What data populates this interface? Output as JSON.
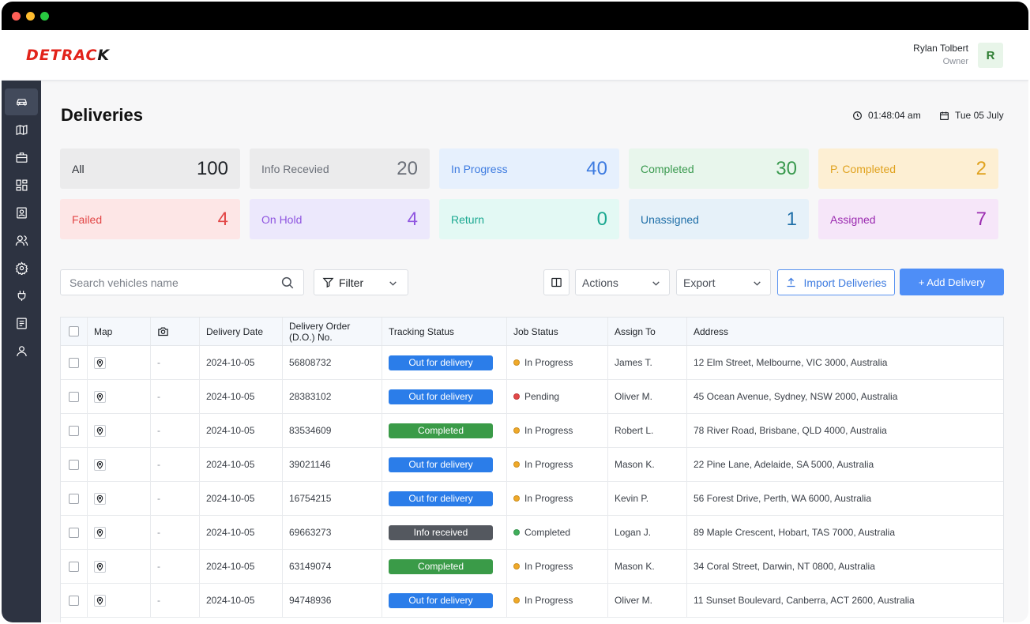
{
  "brand": {
    "logo_main": "DETRAC",
    "logo_tail": "K"
  },
  "user": {
    "name": "Rylan Tolbert",
    "role": "Owner",
    "initial": "R"
  },
  "page": {
    "title": "Deliveries",
    "time": "01:48:04 am",
    "date": "Tue 05 July"
  },
  "sidebar": {
    "items": [
      {
        "icon": "car-icon",
        "active": true
      },
      {
        "icon": "map-icon",
        "active": false
      },
      {
        "icon": "briefcase-icon",
        "active": false
      },
      {
        "icon": "dashboard-icon",
        "active": false
      },
      {
        "icon": "contact-card-icon",
        "active": false
      },
      {
        "icon": "users-icon",
        "active": false
      },
      {
        "icon": "settings-icon",
        "active": false
      },
      {
        "icon": "plug-icon",
        "active": false
      },
      {
        "icon": "document-icon",
        "active": false
      },
      {
        "icon": "user-icon",
        "active": false
      }
    ]
  },
  "status_cards": [
    {
      "label": "All",
      "count": "100",
      "bg": "#ebebec",
      "fg": "#2b2f36",
      "count_fg": "#1f2328"
    },
    {
      "label": "Info Recevied",
      "count": "20",
      "bg": "#ebebec",
      "fg": "#6b7079",
      "count_fg": "#6b7079"
    },
    {
      "label": "In Progress",
      "count": "40",
      "bg": "#e6f0fd",
      "fg": "#3d7be0",
      "count_fg": "#3d7be0"
    },
    {
      "label": "Completed",
      "count": "30",
      "bg": "#e8f6ec",
      "fg": "#3a9a4f",
      "count_fg": "#3a9a4f"
    },
    {
      "label": "P. Completed",
      "count": "2",
      "bg": "#fdefd3",
      "fg": "#e0a21e",
      "count_fg": "#e0a21e"
    },
    {
      "label": "Failed",
      "count": "4",
      "bg": "#fde6e6",
      "fg": "#e24646",
      "count_fg": "#e24646"
    },
    {
      "label": "On Hold",
      "count": "4",
      "bg": "#ece8fc",
      "fg": "#8f55e0",
      "count_fg": "#8f55e0"
    },
    {
      "label": "Return",
      "count": "0",
      "bg": "#e3f9f4",
      "fg": "#1aa890",
      "count_fg": "#1aa890"
    },
    {
      "label": "Unassigned",
      "count": "1",
      "bg": "#e6f1f9",
      "fg": "#1f6fa8",
      "count_fg": "#1f6fa8"
    },
    {
      "label": "Assigned",
      "count": "7",
      "bg": "#f6e6f9",
      "fg": "#9b2bb0",
      "count_fg": "#9b2bb0"
    }
  ],
  "toolbar": {
    "search_placeholder": "Search vehicles name",
    "filter_label": "Filter",
    "actions_label": "Actions",
    "export_label": "Export",
    "import_label": "Import Deliveries",
    "add_label": "+ Add Delivery"
  },
  "table": {
    "headers": {
      "map": "Map",
      "delivery_date": "Delivery Date",
      "do_line1": "Delivery Order",
      "do_line2": "(D.O.) No.",
      "tracking": "Tracking Status",
      "job": "Job Status",
      "assign": "Assign To",
      "address": "Address"
    },
    "status_colors": {
      "Out for delivery": "#2b7de9",
      "Completed": "#3a9b48",
      "Info received": "#54585f"
    },
    "job_colors": {
      "In Progress": "#f0a928",
      "Pending": "#e34848",
      "Completed": "#3fae5a"
    },
    "rows": [
      {
        "photo": "-",
        "date": "2024-10-05",
        "do": "56808732",
        "tracking": "Out for delivery",
        "job": "In Progress",
        "assign": "James T.",
        "address": "12 Elm Street, Melbourne, VIC 3000, Australia"
      },
      {
        "photo": "-",
        "date": "2024-10-05",
        "do": "28383102",
        "tracking": "Out for delivery",
        "job": "Pending",
        "assign": "Oliver M.",
        "address": "45 Ocean Avenue, Sydney, NSW 2000, Australia"
      },
      {
        "photo": "-",
        "date": "2024-10-05",
        "do": "83534609",
        "tracking": "Completed",
        "job": "In Progress",
        "assign": "Robert L.",
        "address": "78 River Road, Brisbane, QLD 4000, Australia"
      },
      {
        "photo": "-",
        "date": "2024-10-05",
        "do": "39021146",
        "tracking": "Out for delivery",
        "job": "In Progress",
        "assign": "Mason K.",
        "address": "22 Pine Lane, Adelaide, SA 5000, Australia"
      },
      {
        "photo": "-",
        "date": "2024-10-05",
        "do": "16754215",
        "tracking": "Out for delivery",
        "job": "In Progress",
        "assign": "Kevin P.",
        "address": "56 Forest Drive, Perth, WA 6000, Australia"
      },
      {
        "photo": "-",
        "date": "2024-10-05",
        "do": "69663273",
        "tracking": "Info received",
        "job": "Completed",
        "assign": "Logan J.",
        "address": "89 Maple Crescent, Hobart, TAS 7000, Australia"
      },
      {
        "photo": "-",
        "date": "2024-10-05",
        "do": "63149074",
        "tracking": "Completed",
        "job": "In Progress",
        "assign": "Mason K.",
        "address": "34 Coral Street, Darwin, NT 0800, Australia"
      },
      {
        "photo": "-",
        "date": "2024-10-05",
        "do": "94748936",
        "tracking": "Out for delivery",
        "job": "In Progress",
        "assign": "Oliver M.",
        "address": "11 Sunset Boulevard, Canberra, ACT 2600, Australia"
      }
    ]
  }
}
